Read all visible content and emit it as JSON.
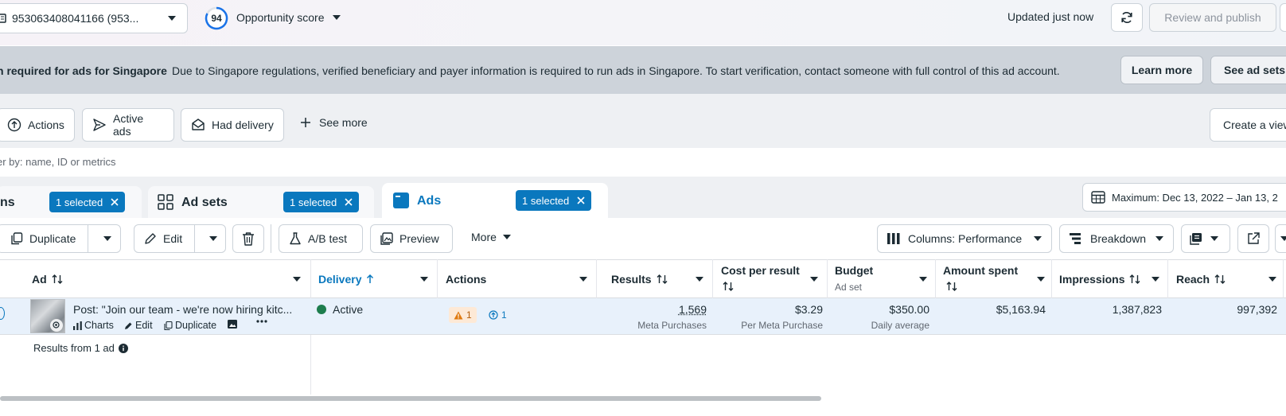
{
  "topbar": {
    "account_label": "953063408041166 (953...",
    "opportunity_score": "94",
    "opportunity_label": "Opportunity score",
    "updated": "Updated just now",
    "review_label": "Review and publish"
  },
  "banner": {
    "title": "n required for ads for Singapore",
    "text": "Due to Singapore regulations, verified beneficiary and payer information is required to run ads in Singapore. To start verification, contact someone with full control of this ad account.",
    "learn_more": "Learn more",
    "see_ad_sets": "See ad sets"
  },
  "filters": {
    "actions": "Actions",
    "active_ads": "Active ads",
    "had_delivery": "Had delivery",
    "see_more": "See more",
    "create_view": "Create a view"
  },
  "search": {
    "placeholder": "er by: name, ID or metrics"
  },
  "tabs": {
    "campaigns_label": "ns",
    "campaigns_selected": "1 selected",
    "adsets_label": "Ad sets",
    "adsets_selected": "1 selected",
    "ads_label": "Ads",
    "ads_selected": "1 selected",
    "date_range": "Maximum: Dec 13, 2022 – Jan 13, 2"
  },
  "toolbar": {
    "duplicate": "Duplicate",
    "edit": "Edit",
    "ab_test": "A/B test",
    "preview": "Preview",
    "more": "More",
    "columns": "Columns: Performance",
    "breakdown": "Breakdown"
  },
  "table": {
    "headers": {
      "ad": "Ad",
      "delivery": "Delivery",
      "actions": "Actions",
      "results": "Results",
      "cost_per_result": "Cost per result",
      "budget": "Budget",
      "budget_sub": "Ad set",
      "amount_spent": "Amount spent",
      "impressions": "Impressions",
      "reach": "Reach"
    },
    "row": {
      "ad_name": "Post: \"Join our team - we're now hiring kitc...",
      "charts": "Charts",
      "edit": "Edit",
      "duplicate": "Duplicate",
      "delivery": "Active",
      "warning_count": "1",
      "action_count": "1",
      "results": "1,569",
      "results_sub": "Meta Purchases",
      "cost": "$3.29",
      "cost_sub": "Per Meta Purchase",
      "budget": "$350.00",
      "budget_sub": "Daily average",
      "amount_spent": "$5,163.94",
      "impressions": "1,387,823",
      "reach": "997,392"
    },
    "footer": "Results from 1 ad"
  },
  "colors": {
    "accent": "#0a78be",
    "active_dot": "#1d7d4d",
    "warning": "#e07a10"
  }
}
